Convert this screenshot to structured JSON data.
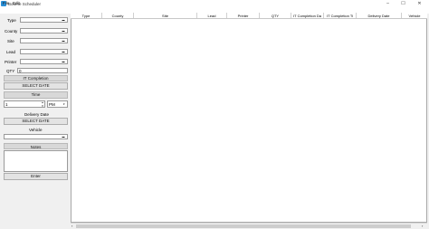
{
  "window": {
    "title": "Bourne Scheduler",
    "minimize_glyph": "–",
    "maximize_glyph": "☐",
    "close_glyph": "✕"
  },
  "menu": {
    "items": [
      "File",
      "Edit"
    ]
  },
  "form": {
    "type_label": "Type",
    "county_label": "County",
    "site_label": "Site",
    "lead_label": "Lead",
    "printer_label": "Printer",
    "qty_label": "QTY",
    "qty_value": "0",
    "it_completion_label": "IT Completion",
    "select_date_1": "SELECT DATE",
    "time_label": "Time",
    "hour_value": "1",
    "ampm_value": "PM",
    "delivery_date_label": "Delivery Date",
    "select_date_2": "SELECT DATE",
    "vehicle_label": "Vehicle",
    "notes_label": "Notes",
    "enter_label": "Enter"
  },
  "grid": {
    "columns": [
      "Type",
      "County",
      "Site",
      "Lead",
      "Printer",
      "QTY",
      "IT Completion Da",
      "IT Completion Ti",
      "Delivery Date",
      "Vehicle"
    ]
  }
}
